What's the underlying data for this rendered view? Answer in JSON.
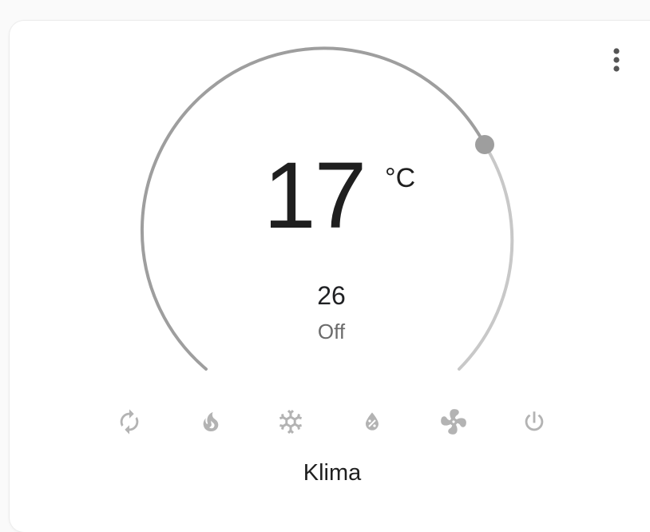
{
  "card": {
    "name": "Klima",
    "current_temperature": "17",
    "unit": "°C",
    "target_temperature": "26",
    "state": "Off",
    "menu_icon": "more-vertical-icon"
  },
  "hvac_modes": [
    {
      "key": "auto",
      "icon": "cycle-icon"
    },
    {
      "key": "heat",
      "icon": "fire-icon"
    },
    {
      "key": "cool",
      "icon": "snowflake-icon"
    },
    {
      "key": "dry",
      "icon": "water-percent-icon"
    },
    {
      "key": "fan_only",
      "icon": "fan-icon"
    },
    {
      "key": "off",
      "icon": "power-icon"
    }
  ],
  "colors": {
    "ring_active": "#9e9e9e",
    "ring_inactive": "#c8c8c8",
    "handle": "#9e9e9e",
    "icon": "#b3b3b3",
    "text_primary": "#1f1f1f",
    "text_secondary": "#6b6b6b"
  }
}
